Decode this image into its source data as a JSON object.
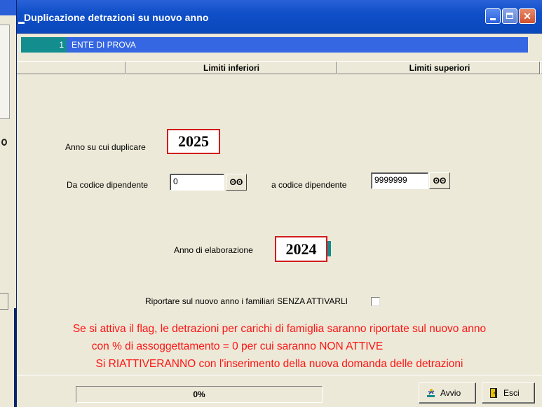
{
  "window": {
    "title": "Duplicazione detrazioni su nuovo anno",
    "title_icon": "app-icon"
  },
  "entity": {
    "code": "1",
    "name": "ENTE DI PROVA"
  },
  "columns": {
    "lower": "Limiti inferiori",
    "upper": "Limiti superiori"
  },
  "form": {
    "year_target_label": "Anno su cui duplicare",
    "year_target_value": "2025",
    "from_code_label": "Da codice dipendente",
    "from_code_value": "0",
    "to_code_label": "a codice dipendente",
    "to_code_value": "9999999",
    "lookup_glyph": "ʘʘ",
    "processing_year_label": "Anno di elaborazione",
    "processing_year_value": "2024",
    "carry_family_label": "Riportare sul nuovo anno i familiari SENZA ATTIVARLI"
  },
  "notes": [
    "Se si attiva il flag, le detrazioni per carichi di famiglia saranno riportate sul nuovo anno",
    "con % di assoggettamento = 0 per cui saranno NON ATTIVE",
    "Si RIATTIVERANNO con l'inserimento della nuova domanda delle detrazioni"
  ],
  "status": {
    "progress_text": "0%",
    "progress_value": 0
  },
  "buttons": {
    "start": "Avvio",
    "exit": "Esci"
  },
  "colors": {
    "title_blue": "#0a47bc",
    "entity_bar": "#3567e3",
    "teal": "#138d8d",
    "highlight_box": "#d21c1c",
    "note_red": "#ff1414",
    "window_bg": "#ece9d8"
  }
}
